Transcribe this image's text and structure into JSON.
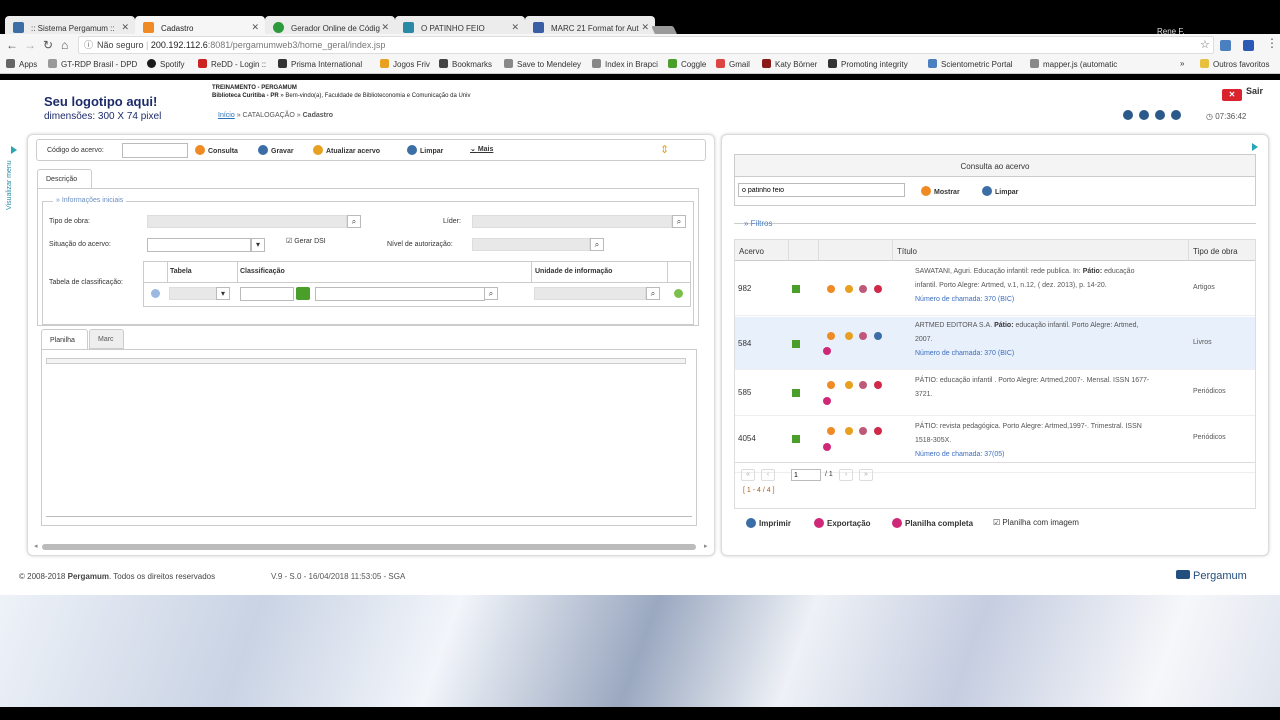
{
  "browser": {
    "tabs": [
      {
        "label": ":: Sistema Pergamum ::",
        "color": "#3a6ea5"
      },
      {
        "label": "Cadastro",
        "color": "#f08a24"
      },
      {
        "label": "Gerador Online de Códig",
        "color": "#2a9a3a"
      },
      {
        "label": "O PATINHO FEIO",
        "color": "#2a8aa5"
      },
      {
        "label": "MARC 21 Format for Aut",
        "color": "#3a5ea5"
      }
    ],
    "user": "Rene F.",
    "nav": {
      "back": "←",
      "forward": "→",
      "reload": "↻",
      "home": "⌂"
    },
    "url": {
      "security": "Não seguro",
      "host": "200.192.112.6",
      "path": ":8081/pergamumweb3/home_geral/index.jsp"
    },
    "star": "☆",
    "bookmarks": [
      {
        "label": "Apps",
        "color": "#666"
      },
      {
        "label": "GT-RDP Brasil - DPD",
        "color": "#999"
      },
      {
        "label": "Spotify",
        "color": "#1a1a1a"
      },
      {
        "label": "ReDD - Login ::",
        "color": "#c22"
      },
      {
        "label": "Prisma International",
        "color": "#333"
      },
      {
        "label": "Jogos Friv",
        "color": "#e8a020"
      },
      {
        "label": "Bookmarks",
        "color": "#444"
      },
      {
        "label": "Save to Mendeley",
        "color": "#888"
      },
      {
        "label": "Index in Brapci",
        "color": "#888"
      },
      {
        "label": "Coggle",
        "color": "#4a9e2a"
      },
      {
        "label": "Gmail",
        "color": "#d44"
      },
      {
        "label": "Katy Börner",
        "color": "#8a1a1a"
      },
      {
        "label": "Promoting integrity",
        "color": "#333"
      },
      {
        "label": "Scientometric Portal",
        "color": "#4a7fc0"
      },
      {
        "label": "mapper.js (automatic",
        "color": "#888"
      },
      {
        "label": "Outros favoritos",
        "color": "#e8c040"
      }
    ],
    "more": "»"
  },
  "header": {
    "logo_title": "Seu logotipo aqui!",
    "logo_sub": "dimensões: 300 X 74 pixel",
    "inst_name": "TREINAMENTO - PERGAMUM",
    "inst_lib": "Biblioteca Curitiba - PR",
    "welcome": "» Bem-vindo(a), Faculdade de Biblioteconomia e Comunicação da Univ",
    "crumb_home": "Início",
    "crumb_sep": "»",
    "crumb_mid": "CATALOGAÇÃO",
    "crumb_cur": "Cadastro",
    "logout": "Sair",
    "logout_x": "✕",
    "clock": "07:36:42"
  },
  "left": {
    "side_menu": "Visualizar menu",
    "acervo_label": "Código do acervo:",
    "buttons": [
      {
        "label": "Consulta",
        "color": "#f08a24"
      },
      {
        "label": "Gravar",
        "color": "#3a6ea5"
      },
      {
        "label": "Atualizar acervo",
        "color": "#e8a020"
      },
      {
        "label": "Limpar",
        "color": "#3a6ea5"
      },
      {
        "label": "Mais",
        "color": "#666"
      }
    ],
    "tab_desc": "Descrição",
    "fieldset": "» Informações iniciais",
    "tipo_obra": "Tipo de obra:",
    "lider": "Líder:",
    "situacao": "Situação do acervo:",
    "gerar_dsi": "Gerar DSI",
    "nivel": "Nível de autorização:",
    "tabela_class": "Tabela de classificação:",
    "col_tabela": "Tabela",
    "col_class": "Classificação",
    "col_unidade": "Unidade de informação",
    "tab_planilha": "Planilha",
    "tab_marc": "Marc"
  },
  "right": {
    "search_header": "Consulta ao acervo",
    "search_value": "o patinho feio",
    "show_btn": "Mostrar",
    "clear_btn": "Limpar",
    "filters": "» Filtros",
    "cols": {
      "acervo": "Acervo",
      "titulo": "Título",
      "tipo": "Tipo de obra"
    },
    "rows": [
      {
        "acervo": "982",
        "line1": "SAWATANI, Aguri. Educação infantil: rede publica. In: ",
        "bold": "Pátio:",
        "line1b": " educação",
        "line2": "infantil. Porto Alegre: Artmed, v.1, n.12, ( dez. 2013), p. 14-20.",
        "chamada": "Número de chamada: 370 (BIC)",
        "tipo": "Artigos"
      },
      {
        "acervo": "584",
        "line1": "ARTMED EDITORA S.A. ",
        "bold": "Pátio:",
        "line1b": " educação infantil. Porto Alegre: Artmed,",
        "line2": "2007.",
        "chamada": "Número de chamada: 370 (BIC)",
        "tipo": "Livros"
      },
      {
        "acervo": "585",
        "line1": "PÁTIO: educação infantil . Porto Alegre: Artmed,2007-. Mensal. ISSN 1677-",
        "bold": "",
        "line1b": "",
        "line2": "3721.",
        "chamada": "",
        "tipo": "Periódicos"
      },
      {
        "acervo": "4054",
        "line1": "PÁTIO: revista pedagógica. Porto Alegre: Artmed,1997-. Trimestral. ISSN",
        "bold": "",
        "line1b": "",
        "line2": "1518-305X.",
        "chamada": "Número de chamada: 37(05)",
        "tipo": "Periódicos"
      }
    ],
    "page_input": "1",
    "page_total": "/ 1",
    "range": "[ 1 - 4 / 4 ]",
    "print": "Imprimir",
    "export": "Exportação",
    "full_sheet": "Planilha completa",
    "with_image": "Planilha com imagem"
  },
  "footer": {
    "copyright_pre": "© 2008-2018",
    "brand": "Pergamum",
    "copyright_post": ". Todos os direitos reservados",
    "version": "V.9 - S.0 - 16/04/2018 11:53:05 - SGA",
    "logo": "Pergamum"
  }
}
